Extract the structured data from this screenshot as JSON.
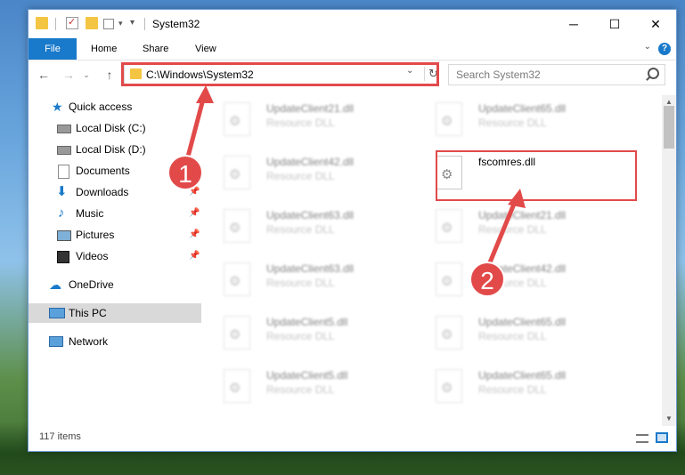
{
  "window": {
    "title": "System32",
    "controls": {
      "minimize": "─",
      "maximize": "☐",
      "close": "✕"
    }
  },
  "ribbon": {
    "tabs": [
      "File",
      "Home",
      "Share",
      "View"
    ],
    "help": "?"
  },
  "nav": {
    "back": "←",
    "forward": "→",
    "up": "↑",
    "address": "C:\\Windows\\System32",
    "refresh": "↻",
    "dropdown": "⌄",
    "search_placeholder": "Search System32"
  },
  "sidebar": {
    "items": [
      {
        "label": "Quick access",
        "icon": "star-icon",
        "pinned": false
      },
      {
        "label": "Local Disk (C:)",
        "icon": "drive-icon",
        "pinned": false
      },
      {
        "label": "Local Disk (D:)",
        "icon": "drive-icon",
        "pinned": false
      },
      {
        "label": "Documents",
        "icon": "documents-icon",
        "pinned": true
      },
      {
        "label": "Downloads",
        "icon": "download-icon",
        "pinned": true
      },
      {
        "label": "Music",
        "icon": "music-icon",
        "pinned": true
      },
      {
        "label": "Pictures",
        "icon": "pictures-icon",
        "pinned": true
      },
      {
        "label": "Videos",
        "icon": "videos-icon",
        "pinned": true
      },
      {
        "label": "OneDrive",
        "icon": "cloud-icon",
        "pinned": false
      },
      {
        "label": "This PC",
        "icon": "computer-icon",
        "pinned": false,
        "selected": true
      },
      {
        "label": "Network",
        "icon": "network-icon",
        "pinned": false
      }
    ]
  },
  "files": {
    "left": [
      {
        "name": "UpdateClient21.dll",
        "type": "Resource DLL"
      },
      {
        "name": "UpdateClient42.dll",
        "type": "Resource DLL"
      },
      {
        "name": "UpdateClient63.dll",
        "type": "Resource DLL"
      },
      {
        "name": "UpdateClient63.dll",
        "type": "Resource DLL"
      },
      {
        "name": "UpdateClient5.dll",
        "type": "Resource DLL"
      },
      {
        "name": "UpdateClient5.dll",
        "type": "Resource DLL"
      }
    ],
    "right": [
      {
        "name": "UpdateClient65.dll",
        "type": "Resource DLL"
      },
      {
        "name": "fscomres.dll",
        "type": "",
        "highlighted": true
      },
      {
        "name": "UpdateClient21.dll",
        "type": "Resource DLL"
      },
      {
        "name": "UpdateClient42.dll",
        "type": "Resource DLL"
      },
      {
        "name": "UpdateClient65.dll",
        "type": "Resource DLL"
      },
      {
        "name": "UpdateClient65.dll",
        "type": "Resource DLL"
      }
    ]
  },
  "status": {
    "item_count": "117 items"
  },
  "callouts": [
    {
      "number": "1",
      "target": "address-bar"
    },
    {
      "number": "2",
      "target": "fscomres.dll"
    }
  ],
  "colors": {
    "accent": "#1979ca",
    "highlight": "#e24a4a",
    "selected": "#d9d9d9"
  }
}
